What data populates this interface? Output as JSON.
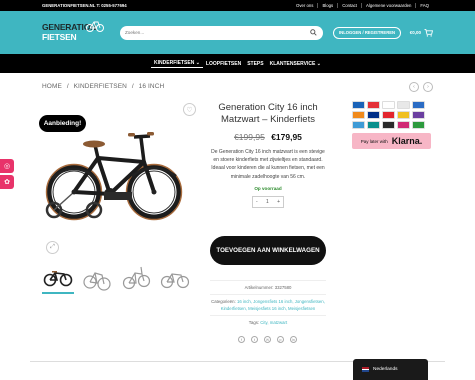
{
  "topbar": {
    "contact": "GENERATIONFIETSEN.NL T: 0255-577694",
    "links": [
      "Over ons",
      "Blogs",
      "Contact",
      "Algemene voorwaarden",
      "FAQ"
    ]
  },
  "header": {
    "logo_line1": "GENERATION",
    "logo_line2": "FIETSEN",
    "search_placeholder": "Zoeken...",
    "login_label": "INLOGGEN / REGISTREREN",
    "cart_total": "€0,00"
  },
  "nav": {
    "items": [
      "KINDERFIETSEN",
      "LOOPFIETSEN",
      "STEPS",
      "KLANTENSERVICE"
    ]
  },
  "breadcrumb": {
    "items": [
      "HOME",
      "KINDERFIETSEN",
      "16 INCH"
    ],
    "separator": "/"
  },
  "gallery": {
    "badge": "Aanbieding!"
  },
  "product": {
    "title": "Generation City 16 inch Matzwart – Kinderfiets",
    "old_price": "€199,95",
    "new_price": "€179,95",
    "description": "De Generation City 16 inch matzwart is een stevige en stoere kinderfiets met zijwieltjes en standaard. Ideaal voor kinderen die al kunnen fietsen, met een minimale zadelhoogte van 56 cm.",
    "stock": "Op voorraad",
    "qty": "1",
    "add_to_cart": "TOEVOEGEN AAN WINKELWAGEN"
  },
  "meta": {
    "sku_label": "Artikelnummer:",
    "sku": "3327580",
    "categories_label": "Categorieën:",
    "categories": "16 inch, Jongensfiets 16 inch, Jongensfietsen, Kinderfietsen, Meisjesfiets 16 inch, Meisjesfietsen",
    "tags_label": "Tags:",
    "tags": "City, matzwart"
  },
  "payments": {
    "klarna_text": "Pay later with",
    "klarna_logo": "Klarna.",
    "colors": [
      "#1a63b8",
      "#e43138",
      "#ffffff",
      "#e8e8e8",
      "#2b6cc4",
      "#f08a1c",
      "#002f87",
      "#e3262e",
      "#f0c022",
      "#6b3fa0",
      "#3f9bd6",
      "#0b8f8c",
      "#2a2a2a",
      "#d02a74",
      "#2d9a3e"
    ]
  },
  "footer": {
    "language": "Nederlands"
  },
  "colors": {
    "brand": "#3fb6c1",
    "badge": "#000000",
    "side_tab": "#e8336a"
  }
}
